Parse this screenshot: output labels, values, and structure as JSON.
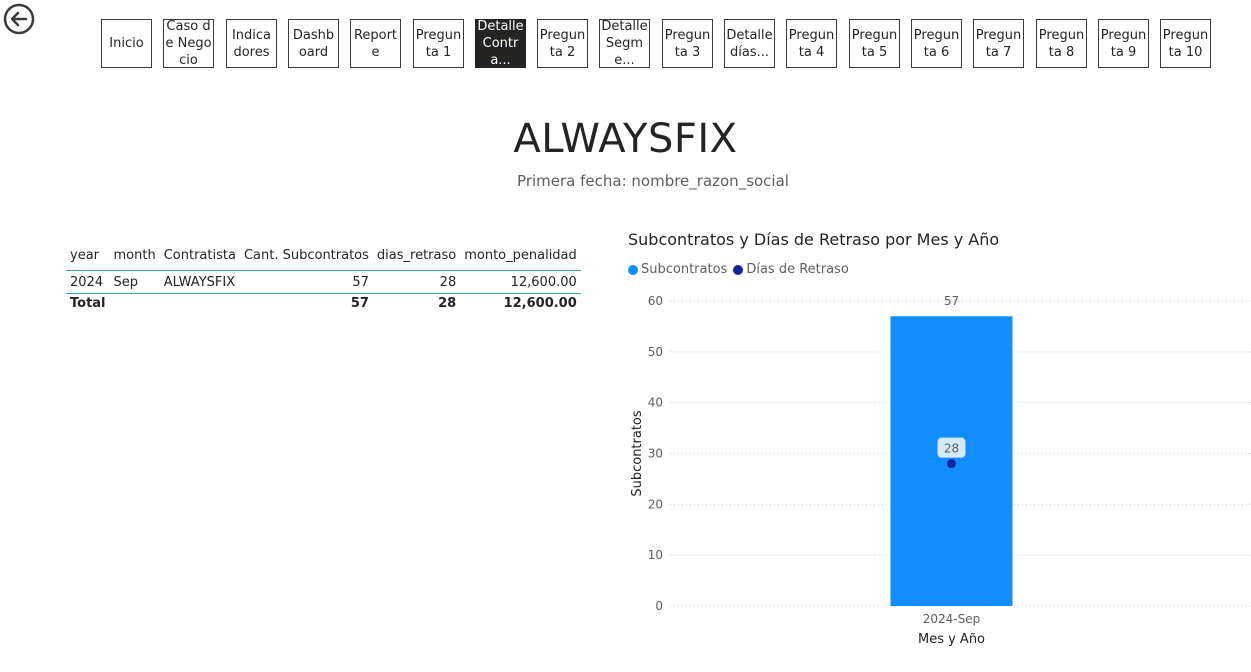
{
  "nav": {
    "buttons": [
      {
        "label": "Inicio",
        "active": false
      },
      {
        "label": "Caso de Negocio",
        "active": false
      },
      {
        "label": "Indicadores",
        "active": false
      },
      {
        "label": "Dashboard",
        "active": false
      },
      {
        "label": "Reporte",
        "active": false
      },
      {
        "label": "Pregunta 1",
        "active": false
      },
      {
        "label": "Detalle Contra...",
        "active": true
      },
      {
        "label": "Pregunta 2",
        "active": false
      },
      {
        "label": "Detalle Segme...",
        "active": false
      },
      {
        "label": "Pregunta 3",
        "active": false
      },
      {
        "label": "Detalle días...",
        "active": false
      },
      {
        "label": "Pregunta 4",
        "active": false
      },
      {
        "label": "Pregunta 5",
        "active": false
      },
      {
        "label": "Pregunta 6",
        "active": false
      },
      {
        "label": "Pregunta 7",
        "active": false
      },
      {
        "label": "Pregunta 8",
        "active": false
      },
      {
        "label": "Pregunta 9",
        "active": false
      },
      {
        "label": "Pregunta 10",
        "active": false
      }
    ]
  },
  "header": {
    "title": "ALWAYSFIX",
    "subtitle": "Primera fecha: nombre_razon_social"
  },
  "table": {
    "columns": [
      "year",
      "month",
      "Contratista",
      "Cant. Subcontratos",
      "dias_retraso",
      "monto_penalidad"
    ],
    "rows": [
      {
        "year": "2024",
        "month": "Sep",
        "contratista": "ALWAYSFIX",
        "cant": "57",
        "dias": "28",
        "monto": "12,600.00"
      }
    ],
    "total": {
      "label": "Total",
      "cant": "57",
      "dias": "28",
      "monto": "12,600.00"
    }
  },
  "chart": {
    "title": "Subcontratos y Días de Retraso por Mes y Año",
    "legend": [
      {
        "name": "Subcontratos",
        "color": "#118dff"
      },
      {
        "name": "Días de Retraso",
        "color": "#12239e"
      }
    ]
  },
  "chart_data": {
    "type": "bar",
    "title": "Subcontratos y Días de Retraso por Mes y Año",
    "xlabel": "Mes y Año",
    "ylabel": "Subcontratos",
    "categories": [
      "2024-Sep"
    ],
    "ylim": [
      0,
      60
    ],
    "yticks": [
      0,
      10,
      20,
      30,
      40,
      50,
      60
    ],
    "grid": true,
    "legend_position": "top-left",
    "series": [
      {
        "name": "Subcontratos",
        "type": "bar",
        "values": [
          57
        ],
        "color": "#118dff"
      },
      {
        "name": "Días de Retraso",
        "type": "point",
        "values": [
          28
        ],
        "color": "#12239e"
      }
    ]
  }
}
